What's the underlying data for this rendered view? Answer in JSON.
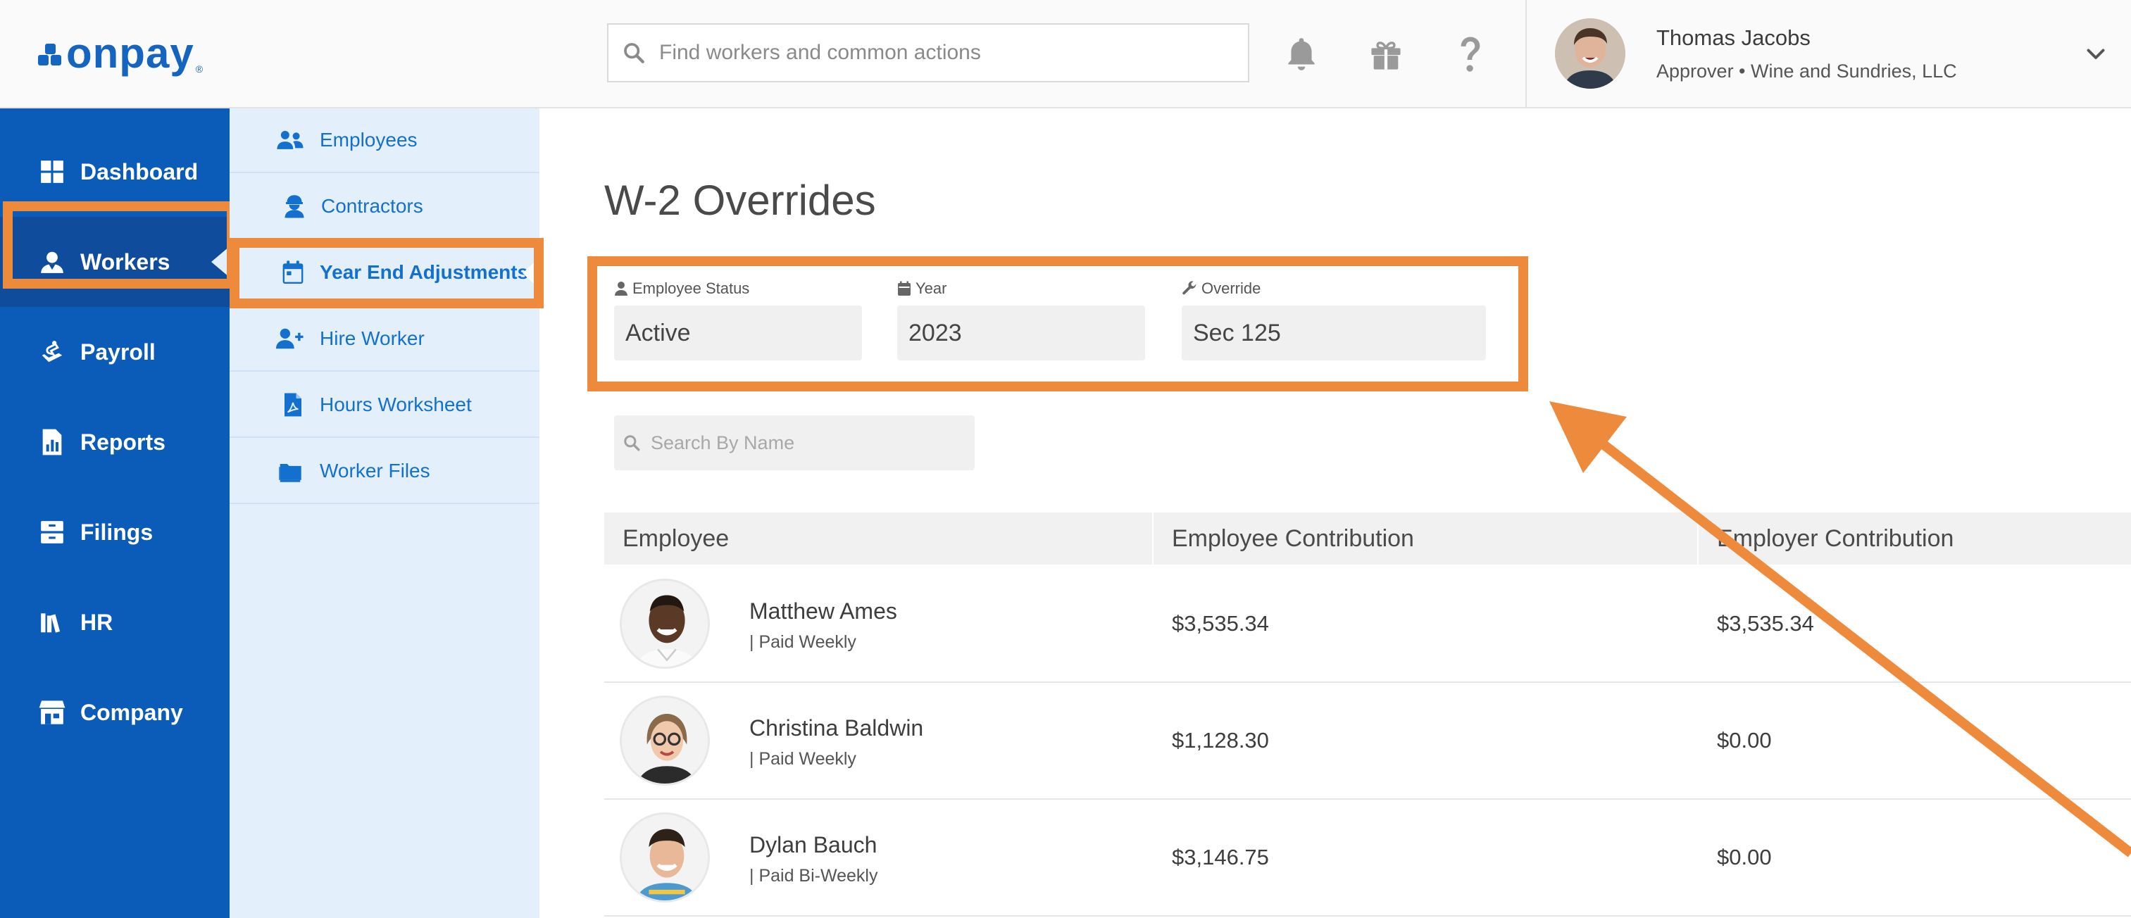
{
  "brand": {
    "name": "onpay",
    "reg": "®"
  },
  "search": {
    "placeholder": "Find workers and common actions"
  },
  "user": {
    "name": "Thomas Jacobs",
    "role": "Approver • Wine and Sundries, LLC"
  },
  "sidebar": {
    "items": [
      {
        "label": "Dashboard",
        "icon": "dashboard-icon"
      },
      {
        "label": "Workers",
        "icon": "workers-icon",
        "active": true
      },
      {
        "label": "Payroll",
        "icon": "payroll-icon"
      },
      {
        "label": "Reports",
        "icon": "reports-icon"
      },
      {
        "label": "Filings",
        "icon": "filings-icon"
      },
      {
        "label": "HR",
        "icon": "hr-icon"
      },
      {
        "label": "Company",
        "icon": "company-icon"
      }
    ]
  },
  "subnav": {
    "items": [
      {
        "label": "Employees",
        "icon": "employees-icon"
      },
      {
        "label": "Contractors",
        "icon": "contractor-icon"
      },
      {
        "label": "Year End Adjustments",
        "icon": "calendar-icon",
        "active": true
      },
      {
        "label": "Hire Worker",
        "icon": "add-user-icon"
      },
      {
        "label": "Hours Worksheet",
        "icon": "pdf-file-icon"
      },
      {
        "label": "Worker Files",
        "icon": "folder-icon"
      }
    ]
  },
  "page": {
    "title": "W-2 Overrides"
  },
  "filters": {
    "status": {
      "label": "Employee Status",
      "value": "Active"
    },
    "year": {
      "label": "Year",
      "value": "2023"
    },
    "override": {
      "label": "Override",
      "value": "Sec 125"
    }
  },
  "name_search": {
    "placeholder": "Search By Name"
  },
  "table": {
    "columns": [
      "Employee",
      "Employee Contribution",
      "Employer Contribution"
    ],
    "rows": [
      {
        "name": "Matthew Ames",
        "frequency": "| Paid Weekly",
        "employee_contribution": "$3,535.34",
        "employer_contribution": "$3,535.34"
      },
      {
        "name": "Christina Baldwin",
        "frequency": "| Paid Weekly",
        "employee_contribution": "$1,128.30",
        "employer_contribution": "$0.00"
      },
      {
        "name": "Dylan Bauch",
        "frequency": "| Paid Bi-Weekly",
        "employee_contribution": "$3,146.75",
        "employer_contribution": "$0.00"
      }
    ]
  },
  "colors": {
    "brand_blue": "#1565c0",
    "sidebar_blue": "#0b5cb8",
    "highlight_orange": "#ee8a3c",
    "subnav_bg": "#e3f0fc"
  }
}
